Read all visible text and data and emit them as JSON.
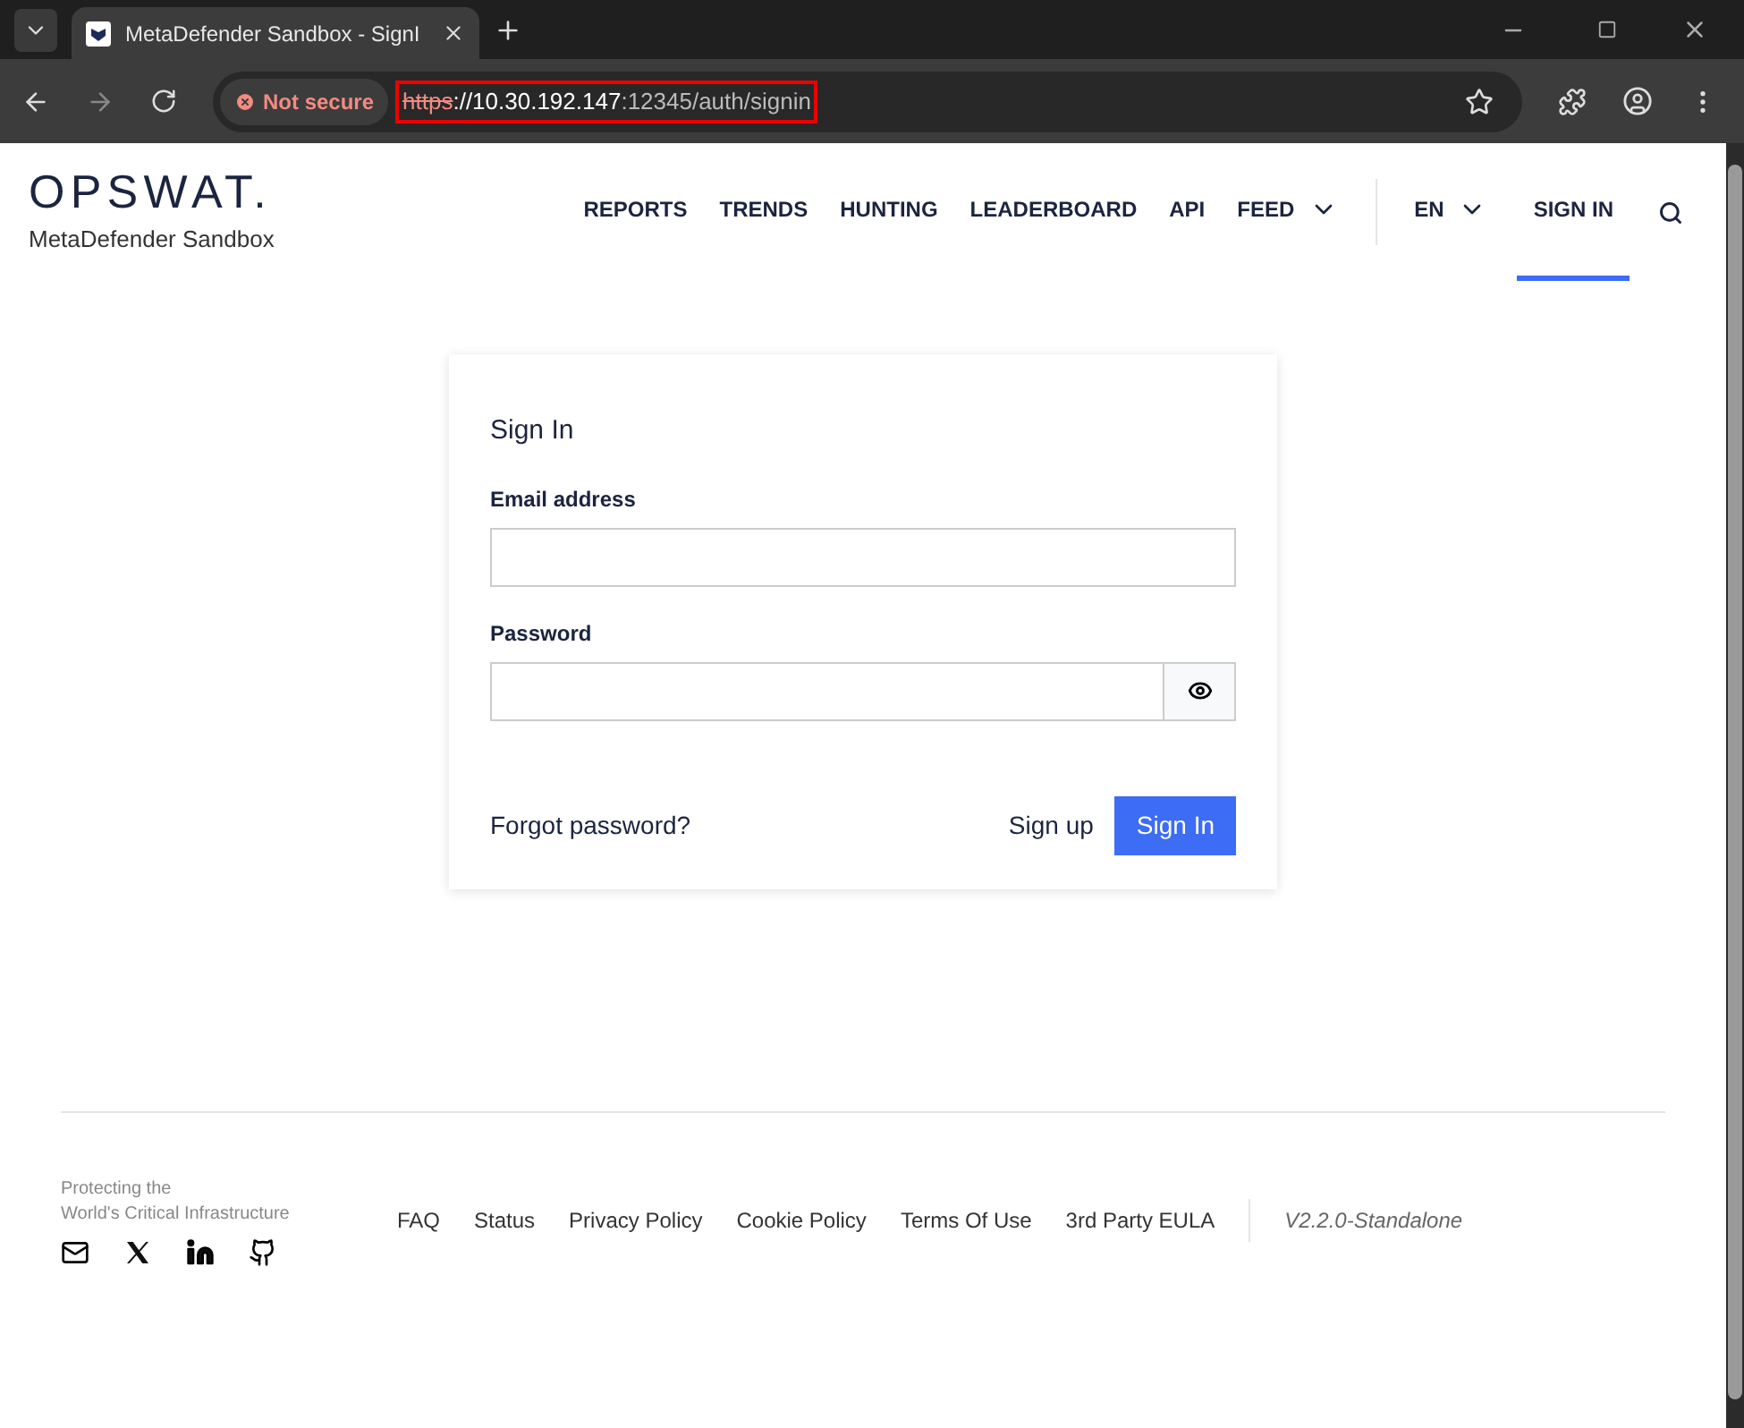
{
  "browser": {
    "tab_title": "MetaDefender Sandbox - SignI",
    "security": "Not secure",
    "url": {
      "scheme": "https",
      "host": "://10.30.192.147",
      "path": ":12345/auth/signin"
    }
  },
  "header": {
    "logo": "OPSWAT.",
    "product": "MetaDefender Sandbox",
    "nav": [
      {
        "label": "REPORTS",
        "kind": "link",
        "selected": false
      },
      {
        "label": "TRENDS",
        "kind": "link",
        "selected": false
      },
      {
        "label": "HUNTING",
        "kind": "link",
        "selected": false
      },
      {
        "label": "LEADERBOARD",
        "kind": "link",
        "selected": false
      },
      {
        "label": "API",
        "kind": "link",
        "selected": false
      },
      {
        "label": "FEED",
        "kind": "dropdown",
        "selected": false
      }
    ],
    "language": "EN",
    "signin": {
      "label": "SIGN IN",
      "selected": true
    }
  },
  "form": {
    "title": "Sign In",
    "email_label": "Email address",
    "password_label": "Password",
    "forgot": "Forgot password?",
    "signup": "Sign up",
    "submit": "Sign In"
  },
  "footer": {
    "tagline": [
      "Protecting the",
      "World's Critical Infrastructure"
    ],
    "links": [
      "FAQ",
      "Status",
      "Privacy Policy",
      "Cookie Policy",
      "Terms Of Use",
      "3rd Party EULA"
    ],
    "version": "V2.2.0-Standalone"
  }
}
